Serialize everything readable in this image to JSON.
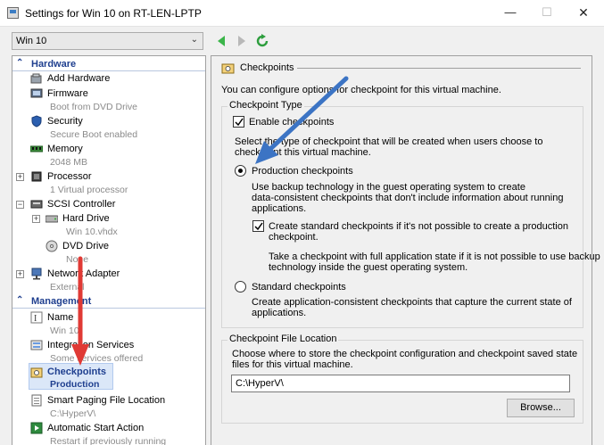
{
  "window": {
    "title": "Settings for Win 10 on RT-LEN-LPTP",
    "minimize": "—",
    "maximize": "☐",
    "close": "✕"
  },
  "vm_selector": {
    "value": "Win 10"
  },
  "sidebar": {
    "hardware_header": "Hardware",
    "management_header": "Management",
    "items": [
      {
        "name": "Add Hardware",
        "sub": ""
      },
      {
        "name": "Firmware",
        "sub": "Boot from DVD Drive"
      },
      {
        "name": "Security",
        "sub": "Secure Boot enabled"
      },
      {
        "name": "Memory",
        "sub": "2048 MB"
      },
      {
        "name": "Processor",
        "sub": "1 Virtual processor"
      },
      {
        "name": "SCSI Controller",
        "sub": ""
      },
      {
        "name": "Hard Drive",
        "sub": "Win 10.vhdx"
      },
      {
        "name": "DVD Drive",
        "sub": "None"
      },
      {
        "name": "Network Adapter",
        "sub": "External"
      },
      {
        "name": "Name",
        "sub": "Win 10"
      },
      {
        "name": "Integration Services",
        "sub": "Some services offered"
      },
      {
        "name": "Checkpoints",
        "sub": "Production"
      },
      {
        "name": "Smart Paging File Location",
        "sub": "C:\\HyperV\\"
      },
      {
        "name": "Automatic Start Action",
        "sub": "Restart if previously running"
      }
    ]
  },
  "main": {
    "title": "Checkpoints",
    "intro": "You can configure options for checkpoint for this virtual machine.",
    "type_group": {
      "title": "Checkpoint Type",
      "enable_label": "Enable checkpoints",
      "select_line1": "Select the type of checkpoint that will be created when users choose to",
      "select_line2": "checkpoint this virtual machine.",
      "production_label": "Production checkpoints",
      "production_desc1": "Use backup technology in the guest operating system to create",
      "production_desc2": "data-consistent checkpoints that don't include information about running",
      "production_desc3": "applications.",
      "fallback_label1": "Create standard checkpoints if it's not possible to create a production",
      "fallback_label2": "checkpoint.",
      "standard_note1": "Take a checkpoint with full application state if it is not possible to use backup",
      "standard_note2": "technology inside the guest operating system.",
      "standard_label": "Standard checkpoints",
      "standard_desc1": "Create application-consistent checkpoints that capture the current state of",
      "standard_desc2": "applications."
    },
    "location_group": {
      "title": "Checkpoint File Location",
      "desc1": "Choose where to store the checkpoint configuration and checkpoint saved state",
      "desc2": "files for this virtual machine.",
      "path_value": "C:\\HyperV\\",
      "browse_label": "Browse..."
    }
  },
  "colors": {
    "accent": "#1f3f8f",
    "arrow_blue": "#3c74c4",
    "arrow_red": "#e03a35"
  }
}
